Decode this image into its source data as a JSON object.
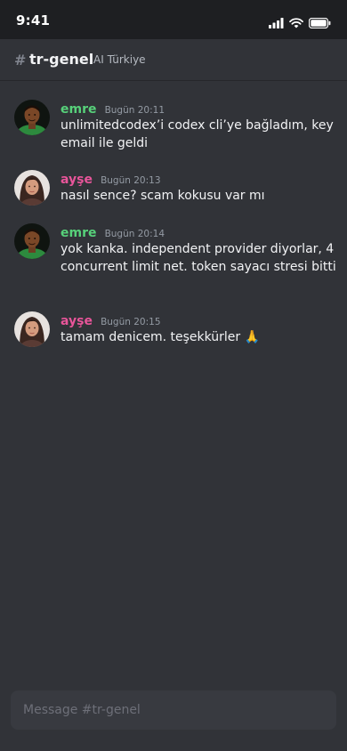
{
  "status_bar": {
    "time": "9:41",
    "icons": [
      "signal-icon",
      "wifi-icon",
      "battery-icon"
    ]
  },
  "channel": {
    "hash": "#",
    "name": "tr-genel",
    "server": "AI Türkiye"
  },
  "messages": [
    {
      "author": "emre",
      "timestamp": "Bugün 20:11",
      "text": "unlimitedcodex’i codex cli’ye bağladım, key email ile geldi"
    },
    {
      "author": "ayşe",
      "timestamp": "Bugün 20:13",
      "text": "nasıl sence? scam kokusu var mı"
    },
    {
      "author": "emre",
      "timestamp": "Bugün 20:14",
      "text": "yok kanka. independent provider diyorlar, 4 concurrent limit net. token sayacı stresi bitti"
    },
    {
      "author": "ayşe",
      "timestamp": "Bugün 20:15",
      "text": "tamam denicem. teşekkürler 🙏"
    }
  ],
  "colors": {
    "background": "#313338",
    "status_bar": "#1e1f22",
    "emre_name": "#57d17a",
    "ayse_name": "#e8559a",
    "composer": "#383a40"
  },
  "composer": {
    "placeholder": "Message #tr-genel",
    "value": ""
  }
}
